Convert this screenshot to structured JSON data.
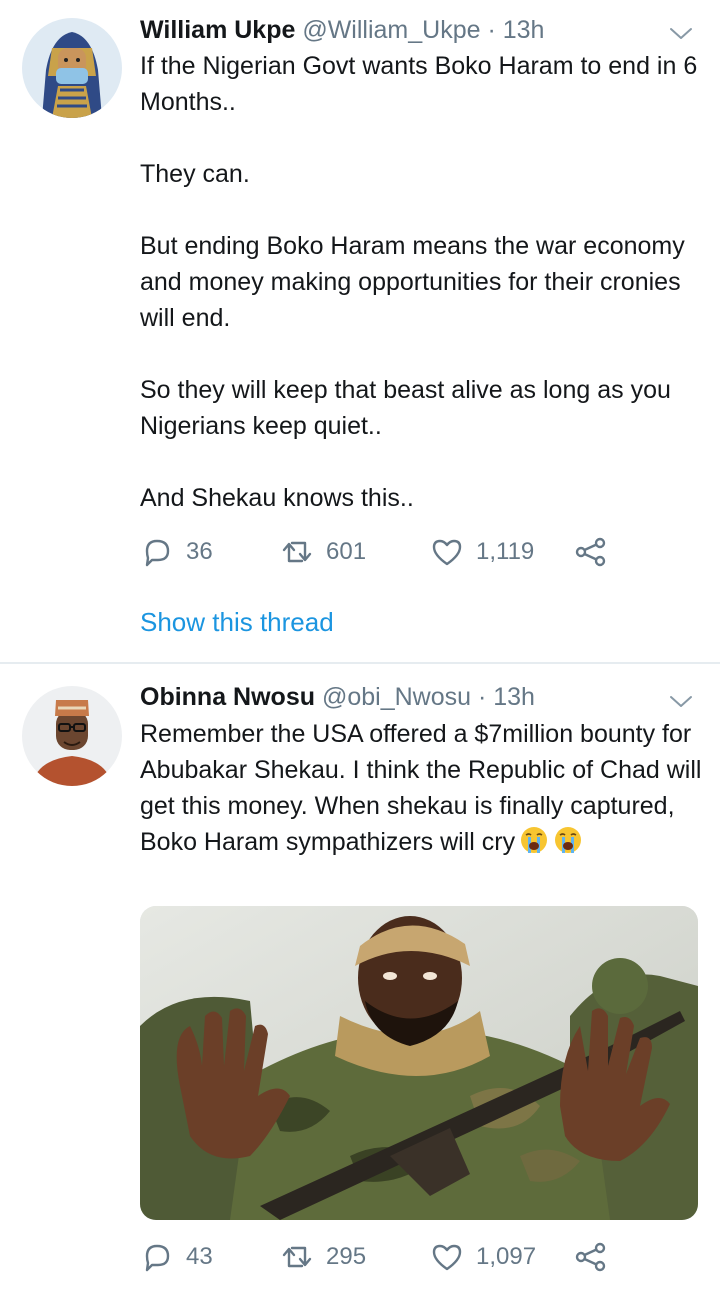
{
  "colors": {
    "text": "#14171a",
    "secondary": "#657786",
    "link": "#1b95e0",
    "divider": "#e6ecf0"
  },
  "tweets": [
    {
      "author": {
        "name": "William Ukpe",
        "handle": "@William_Ukpe",
        "separator": "·",
        "time": "13h",
        "avatar_icon": "avatar-masked-pharaoh"
      },
      "paragraphs": [
        "If the Nigerian Govt wants Boko Haram to end in 6 Months..",
        "They can.",
        "But ending Boko Haram means the war economy and money making opportunities for their cronies will end.",
        "So they will keep that beast alive as long as you Nigerians keep quiet..",
        "And Shekau knows this.."
      ],
      "stats": {
        "replies": "36",
        "retweets": "601",
        "likes": "1,119"
      },
      "thread_link": "Show this thread"
    },
    {
      "author": {
        "name": "Obinna Nwosu",
        "handle": "@obi_Nwosu",
        "separator": "·",
        "time": "13h",
        "avatar_icon": "avatar-man-with-cap"
      },
      "paragraphs": [
        "Remember the USA offered a $7million bounty for Abubakar Shekau. I think the Republic of Chad will get this money. When shekau is finally captured, Boko Haram sympathizers will cry"
      ],
      "emoji": [
        "loudly-crying-face",
        "loudly-crying-face"
      ],
      "media_icon": "photo-man-in-camouflage-with-rifle",
      "stats": {
        "replies": "43",
        "retweets": "295",
        "likes": "1,097"
      }
    }
  ]
}
